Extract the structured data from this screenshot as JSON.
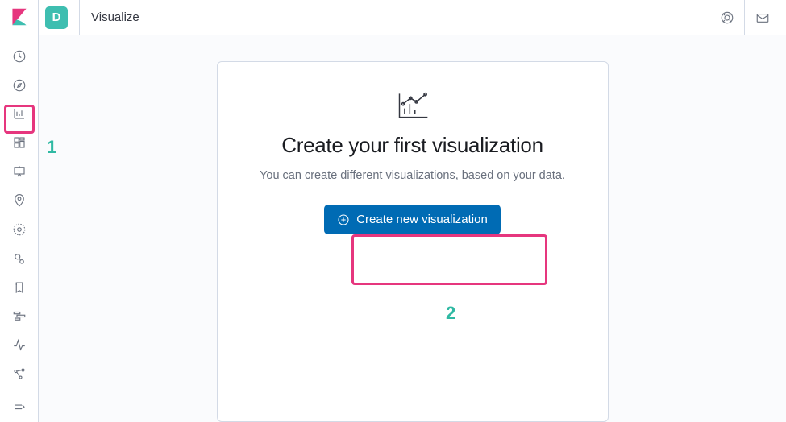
{
  "header": {
    "space_initial": "D",
    "breadcrumb": "Visualize"
  },
  "sidebar": {
    "items": [
      {
        "name": "recently-viewed",
        "icon": "clock-icon"
      },
      {
        "name": "discover",
        "icon": "compass-icon"
      },
      {
        "name": "visualize",
        "icon": "visualize-icon"
      },
      {
        "name": "dashboard",
        "icon": "dashboard-icon"
      },
      {
        "name": "canvas",
        "icon": "canvas-icon"
      },
      {
        "name": "maps",
        "icon": "maps-icon"
      },
      {
        "name": "machine-learning",
        "icon": "ml-icon"
      },
      {
        "name": "metrics",
        "icon": "metrics-icon"
      },
      {
        "name": "logs",
        "icon": "logs-icon"
      },
      {
        "name": "apm",
        "icon": "apm-icon"
      },
      {
        "name": "uptime",
        "icon": "uptime-icon"
      },
      {
        "name": "graph",
        "icon": "graph-icon"
      },
      {
        "name": "collapse",
        "icon": "collapse-icon"
      }
    ]
  },
  "card": {
    "title": "Create your first visualization",
    "description": "You can create different visualizations, based on your data.",
    "button_label": "Create new visualization"
  },
  "annotations": {
    "one": "1",
    "two": "2"
  },
  "colors": {
    "accent": "#006bb4",
    "highlight": "#e6367e",
    "annotation": "#2fb9a3",
    "space_badge": "#3ebeb0"
  }
}
